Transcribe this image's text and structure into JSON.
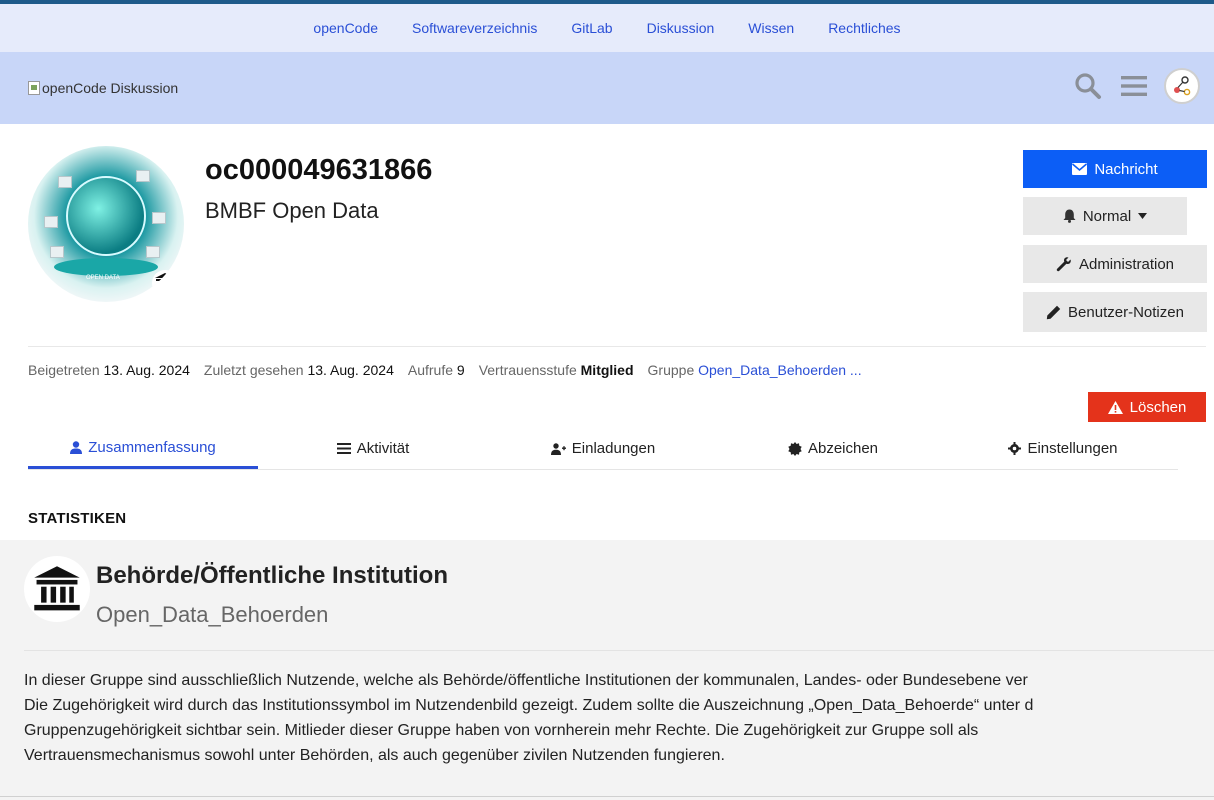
{
  "topnav": {
    "links": [
      "openCode",
      "Softwareverzeichnis",
      "GitLab",
      "Diskussion",
      "Wissen",
      "Rechtliches"
    ]
  },
  "header": {
    "logo_alt": "openCode Diskussion"
  },
  "profile": {
    "username": "oc000049631866",
    "name": "BMBF Open Data",
    "avatar_text": "OPEN DATA"
  },
  "actions": {
    "message": "Nachricht",
    "notification": "Normal",
    "admin": "Administration",
    "notes": "Benutzer-Notizen",
    "delete": "Löschen"
  },
  "meta": {
    "joined_label": "Beigetreten",
    "joined_value": "13. Aug. 2024",
    "seen_label": "Zuletzt gesehen",
    "seen_value": "13. Aug. 2024",
    "views_label": "Aufrufe",
    "views_value": "9",
    "trust_label": "Vertrauensstufe",
    "trust_value": "Mitglied",
    "group_label": "Gruppe",
    "group_value": "Open_Data_Behoerden ..."
  },
  "tabs": [
    "Zusammenfassung",
    "Aktivität",
    "Einladungen",
    "Abzeichen",
    "Einstellungen"
  ],
  "stats_title": "STATISTIKEN",
  "group": {
    "title": "Behörde/Öffentliche Institution",
    "slug": "Open_Data_Behoerden",
    "description": "In dieser Gruppe sind ausschließlich Nutzende, welche als Behörde/öffentliche Institutionen der kommunalen, Landes- oder Bundesebene ver\nDie Zugehörigkeit wird durch das Institutionssymbol im Nutzendenbild gezeigt. Zudem sollte die Auszeichnung „Open_Data_Behoerde“ unter d\nGruppenzugehörigkeit sichtbar sein. Mitlieder dieser Gruppe haben von vornherein mehr Rechte. Die Zugehörigkeit zur Gruppe soll als\nVertrauensmechanismus sowohl unter Behörden, als auch gegenüber zivilen Nutzenden fungieren."
  },
  "colors": {
    "topnav_bg": "#e6ebfb",
    "header_bg": "#c8d6f8",
    "link": "#2a4fd6",
    "primary": "#0c5ef6",
    "danger": "#e4331b"
  }
}
